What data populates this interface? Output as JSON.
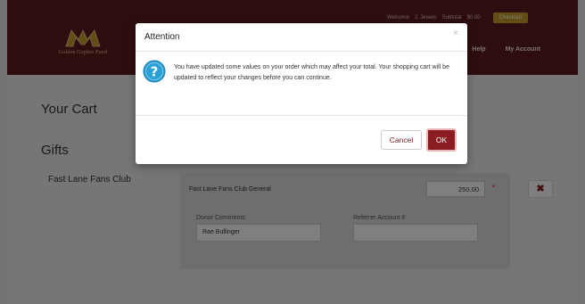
{
  "header": {
    "logo_text": "Golden Gopher Fund",
    "welcome": "Welcome",
    "user": "J. Jewels",
    "subtotal_label": "Subtotal",
    "subtotal_value": "$0.00",
    "checkout_label": "Checkout",
    "nav": [
      {
        "label": "Help"
      },
      {
        "label": "My Account"
      }
    ]
  },
  "page": {
    "cart_heading": "Your Cart",
    "gifts_heading": "Gifts",
    "gift": {
      "name": "Fast Lane Fans Club",
      "fund_label": "Fast Lane Fans Club General",
      "amount": "250.00",
      "required_marker": "*",
      "donor_comments_label": "Donor Comments",
      "donor_comments_value": "Rae Bullinger",
      "referrer_label": "Referrer Account #",
      "referrer_value": ""
    },
    "remove_icon": "✖"
  },
  "modal": {
    "title": "Attention",
    "close_icon": "×",
    "icon": "question-icon",
    "icon_glyph": "?",
    "message": "You have updated some values on your order which may affect your total. Your shopping cart will be updated to reflect your changes before you can continue.",
    "cancel_label": "Cancel",
    "ok_label": "OK"
  },
  "colors": {
    "brand_maroon": "#8a1c22",
    "header_bg": "#5c1a1e",
    "gold": "#c59b2a",
    "info_blue": "#2a9fd6"
  }
}
